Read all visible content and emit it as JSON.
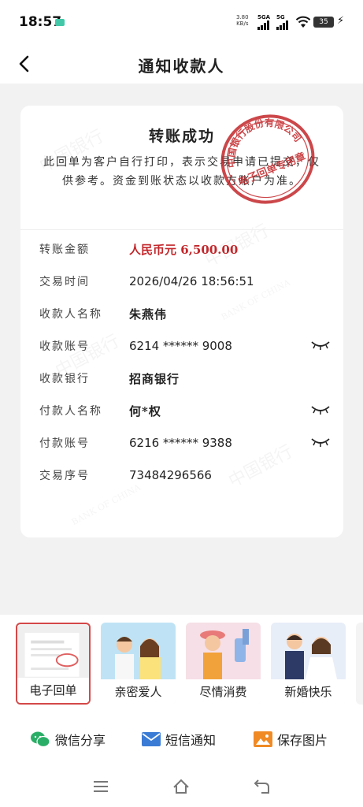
{
  "status": {
    "time": "18:57",
    "net_speed_value": "3.80",
    "net_speed_unit": "KB/s",
    "sig1_label": "5GA",
    "sig2_label": "5G",
    "battery": "35"
  },
  "header": {
    "title": "通知收款人"
  },
  "receipt": {
    "title": "转账成功",
    "notice": "此回单为客户自行打印，表示交易申请已提交，仅供参考。资金到账状态以收款方账户为准。",
    "stamp_top": "中国银行股份有限公司",
    "stamp_bottom": "电子回单专用章",
    "watermark_cn": "中国银行",
    "watermark_en": "BANK OF CHINA",
    "rows": [
      {
        "label": "转账金额",
        "value": "人民币元 6,500.00"
      },
      {
        "label": "交易时间",
        "value": "2026/04/26 18:56:51"
      },
      {
        "label": "收款人名称",
        "value": "朱燕伟"
      },
      {
        "label": "收款账号",
        "value": "6214 ****** 9008"
      },
      {
        "label": "收款银行",
        "value": "招商银行"
      },
      {
        "label": "付款人名称",
        "value": "何*权"
      },
      {
        "label": "付款账号",
        "value": "6216 ****** 9388"
      },
      {
        "label": "交易序号",
        "value": "73484296566"
      }
    ]
  },
  "templates": [
    {
      "label": "电子回单",
      "selected": true
    },
    {
      "label": "亲密爱人",
      "selected": false
    },
    {
      "label": "尽情消费",
      "selected": false
    },
    {
      "label": "新婚快乐",
      "selected": false
    }
  ],
  "share": {
    "wechat": "微信分享",
    "sms": "短信通知",
    "save": "保存图片"
  },
  "colors": {
    "accent_red": "#c3272b",
    "wechat_green": "#2aae67",
    "sms_blue": "#3a7bd5",
    "save_orange": "#f08a24"
  }
}
